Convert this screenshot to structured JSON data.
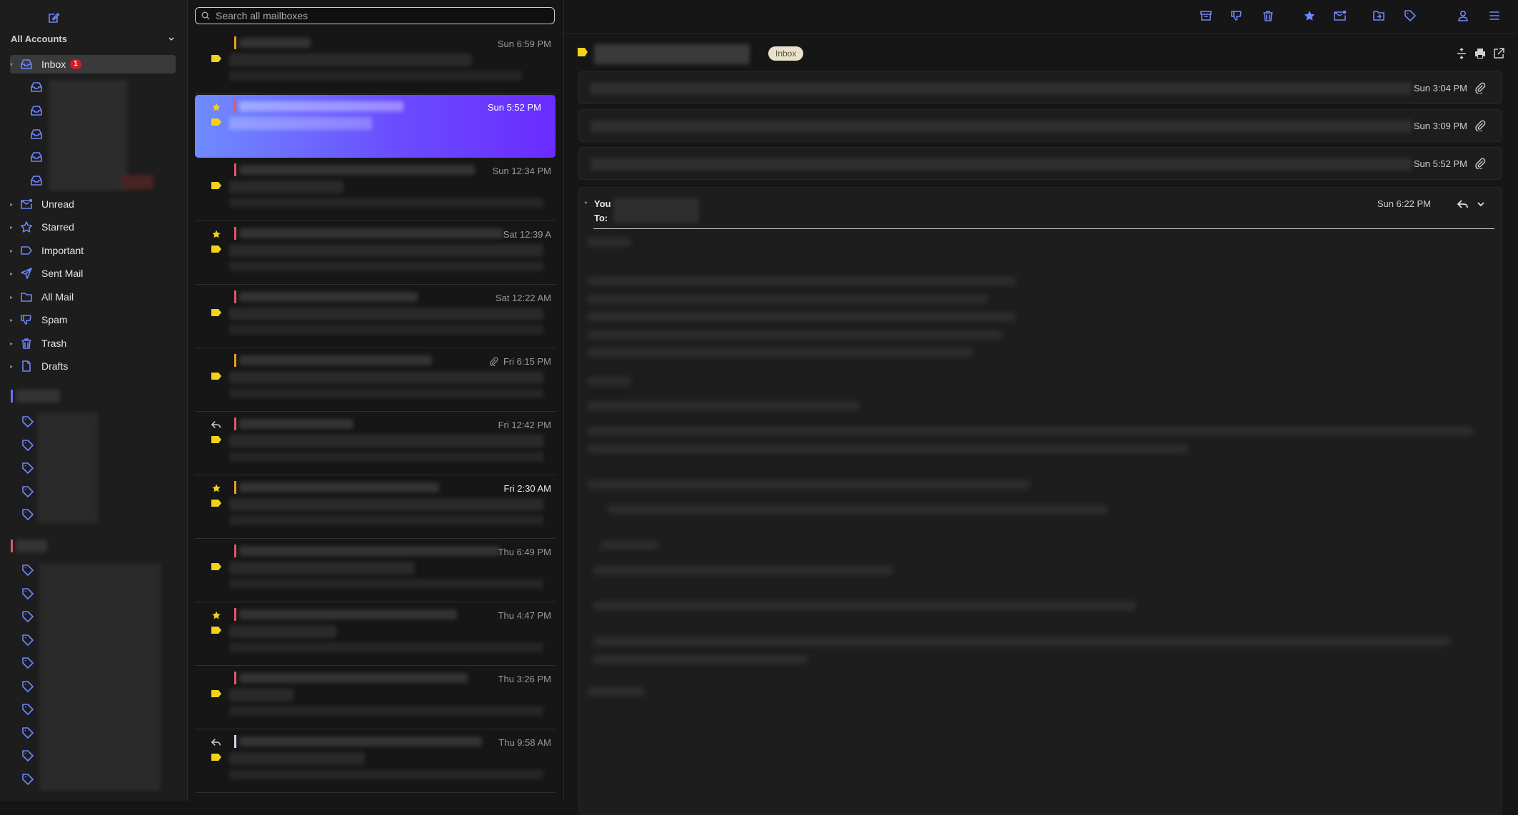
{
  "sidebar": {
    "accounts_label": "All Accounts",
    "inbox": {
      "label": "Inbox",
      "badge": "1"
    },
    "folders": [
      {
        "id": "unread",
        "label": "Unread",
        "icon": "unread-mail-icon"
      },
      {
        "id": "starred",
        "label": "Starred",
        "icon": "star-icon"
      },
      {
        "id": "important",
        "label": "Important",
        "icon": "important-label-icon"
      },
      {
        "id": "sent",
        "label": "Sent Mail",
        "icon": "send-icon"
      },
      {
        "id": "all",
        "label": "All Mail",
        "icon": "folder-icon"
      },
      {
        "id": "spam",
        "label": "Spam",
        "icon": "thumbs-down-icon"
      },
      {
        "id": "trash",
        "label": "Trash",
        "icon": "trash-icon"
      },
      {
        "id": "drafts",
        "label": "Drafts",
        "icon": "document-icon"
      }
    ]
  },
  "search": {
    "placeholder": "Search all mailboxes"
  },
  "messages": [
    {
      "time": "Sun 6:59 PM",
      "color": "#f0a020"
    },
    {
      "time": "Sun 5:52 PM",
      "color": "#e05a6a",
      "selected": true,
      "starred": true
    },
    {
      "time": "Sun 12:34 PM",
      "color": "#e05a6a"
    },
    {
      "time": "Sat 12:39 A",
      "color": "#e05a6a",
      "starred": true
    },
    {
      "time": "Sat 12:22 AM",
      "color": "#e05a6a"
    },
    {
      "time": "Fri 6:15 PM",
      "color": "#f0a020",
      "attachment": true
    },
    {
      "time": "Fri 12:42 PM",
      "color": "#e05a6a",
      "replied": true
    },
    {
      "time": "Fri 2:30 AM",
      "color": "#f0a020",
      "starred": true,
      "unread": true
    },
    {
      "time": "Thu 6:49 PM",
      "color": "#e05a6a"
    },
    {
      "time": "Thu 4:47 PM",
      "color": "#e05a6a",
      "starred": true
    },
    {
      "time": "Thu 3:26 PM",
      "color": "#e05a6a"
    },
    {
      "time": "Thu 9:58 AM",
      "color": "#d8d8f0",
      "replied": true
    }
  ],
  "reading": {
    "folder_chip": "Inbox",
    "thread": [
      {
        "time": "Sun 3:04 PM"
      },
      {
        "time": "Sun 3:09 PM"
      },
      {
        "time": "Sun 5:52 PM"
      }
    ],
    "open": {
      "from_label": "You",
      "to_label": "To:",
      "time": "Sun 6:22 PM"
    }
  },
  "colors": {
    "accent": "#6f86ff",
    "tag_yellow": "#f2d21b",
    "badge_red": "#c8202b"
  }
}
